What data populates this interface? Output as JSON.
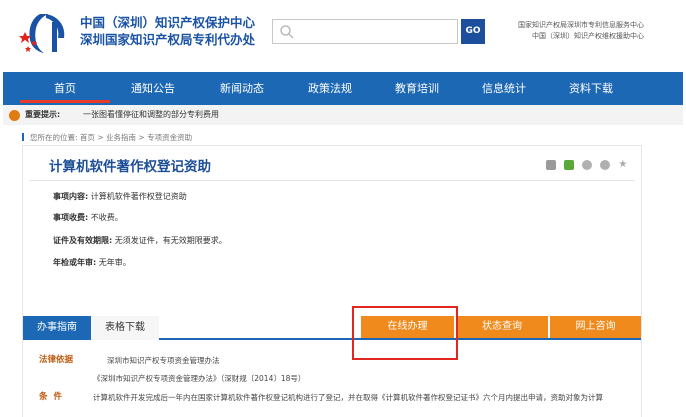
{
  "header": {
    "org_line1": "中国（深圳）知识产权保护中心",
    "org_line2": "深圳国家知识产权局专利代办处",
    "search_placeholder": "",
    "search_button": "GO",
    "right_line1": "国家知识产权局深圳市专利信息服务中心",
    "right_line2": "中国（深圳）知识产权维权援助中心"
  },
  "nav": {
    "items": [
      "首页",
      "通知公告",
      "新闻动态",
      "政策法规",
      "教育培训",
      "信息统计",
      "资料下载"
    ],
    "active": "首页"
  },
  "notice": {
    "label": "重要提示:",
    "message": "一张图看懂停征和调整的部分专利费用"
  },
  "breadcrumb": {
    "prefix": "您所在的位置:",
    "items": [
      "首页",
      "业务指南",
      "专项资金资助"
    ],
    "separator": ">"
  },
  "page": {
    "title": "计算机软件著作权登记资助",
    "fields": [
      {
        "label": "事项内容:",
        "value": "计算机软件著作权登记资助"
      },
      {
        "label": "事项收费:",
        "value": "不收费。"
      },
      {
        "label": "证件及有效期限:",
        "value": "无须发证件，有无效期限要求。"
      },
      {
        "label": "年检或年审:",
        "value": "无年审。"
      }
    ]
  },
  "tabs": {
    "guide": "办事指南",
    "forms": "表格下载"
  },
  "actions": {
    "online": "在线办理",
    "status": "状态查询",
    "web": "网上咨询"
  },
  "law": {
    "label": "法律依据",
    "line1": "深圳市知识产权专项资金管理办法",
    "line2": "《深圳市知识产权专项资金管理办法》（深财规〔2014〕18号）"
  },
  "condition": {
    "label": "条件",
    "text": "计算机软件开发完成后一年内在国家计算机软件著作权登记机构进行了登记，并在取得《计算机软件著作权登记证书》六个月内提出申请，资助对象为计算"
  },
  "colors": {
    "nav_blue": "#1d68b5",
    "action_orange": "#f08a1c",
    "highlight_red": "#e0261d"
  }
}
